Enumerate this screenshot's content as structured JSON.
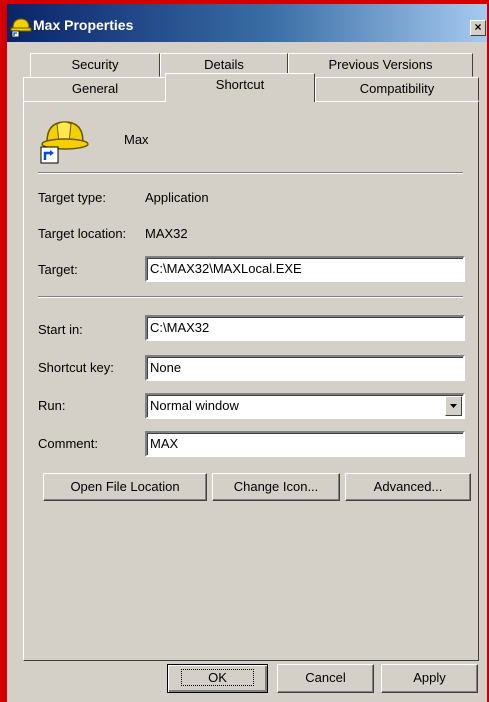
{
  "window": {
    "title": "Max Properties",
    "close_glyph": "×"
  },
  "tabs": {
    "row1": [
      "Security",
      "Details",
      "Previous Versions"
    ],
    "row2": [
      "General",
      "Shortcut",
      "Compatibility"
    ],
    "active": "Shortcut"
  },
  "header": {
    "name": "Max",
    "icon": "hardhat-shortcut-icon"
  },
  "info": {
    "target_type_label": "Target type:",
    "target_type_value": "Application",
    "target_location_label": "Target location:",
    "target_location_value": "MAX32"
  },
  "fields": {
    "target_label": "Target:",
    "target_value": "C:\\MAX32\\MAXLocal.EXE",
    "start_in_label": "Start in:",
    "start_in_value": "C:\\MAX32",
    "shortcut_key_label": "Shortcut key:",
    "shortcut_key_value": "None",
    "run_label": "Run:",
    "run_value": "Normal window",
    "comment_label": "Comment:",
    "comment_value": "MAX"
  },
  "action_buttons": {
    "open_file_location": "Open File Location",
    "change_icon": "Change Icon...",
    "advanced": "Advanced..."
  },
  "dialog_buttons": {
    "ok": "OK",
    "cancel": "Cancel",
    "apply": "Apply"
  }
}
